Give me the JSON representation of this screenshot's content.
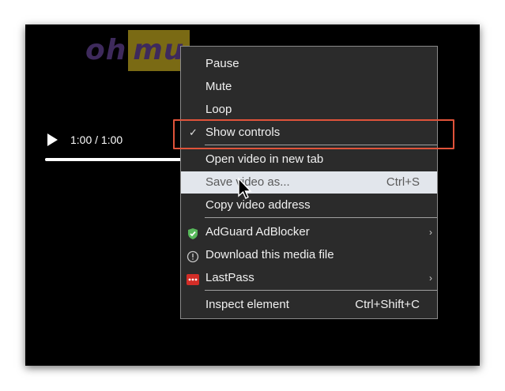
{
  "video": {
    "logo_part1": "oh",
    "logo_part2": "mu",
    "time_display": "1:00 / 1:00",
    "progress": 1.0,
    "icons": {
      "play": "play-icon"
    }
  },
  "context_menu": {
    "items": [
      {
        "label": "Pause"
      },
      {
        "label": "Mute"
      },
      {
        "label": "Loop"
      },
      {
        "label": "Show controls",
        "checked": true
      },
      {
        "label": "Open video in new tab"
      },
      {
        "label": "Save video as...",
        "shortcut": "Ctrl+S"
      },
      {
        "label": "Copy video address"
      },
      {
        "label": "AdGuard AdBlocker",
        "icon": "adguard-shield-icon",
        "submenu_glyph": "›"
      },
      {
        "label": "Download this media file",
        "icon": "info-circle-icon"
      },
      {
        "label": "LastPass",
        "icon": "lastpass-icon",
        "submenu_glyph": "›"
      },
      {
        "label": "Inspect element",
        "shortcut": "Ctrl+Shift+C"
      }
    ],
    "check_glyph": "✓"
  },
  "colors": {
    "menu_bg": "#2b2b2b",
    "hover_bg": "#e2e6ec",
    "annotation_red": "#e0533a",
    "adguard_green": "#57b85a",
    "lastpass_red": "#d32d27"
  }
}
